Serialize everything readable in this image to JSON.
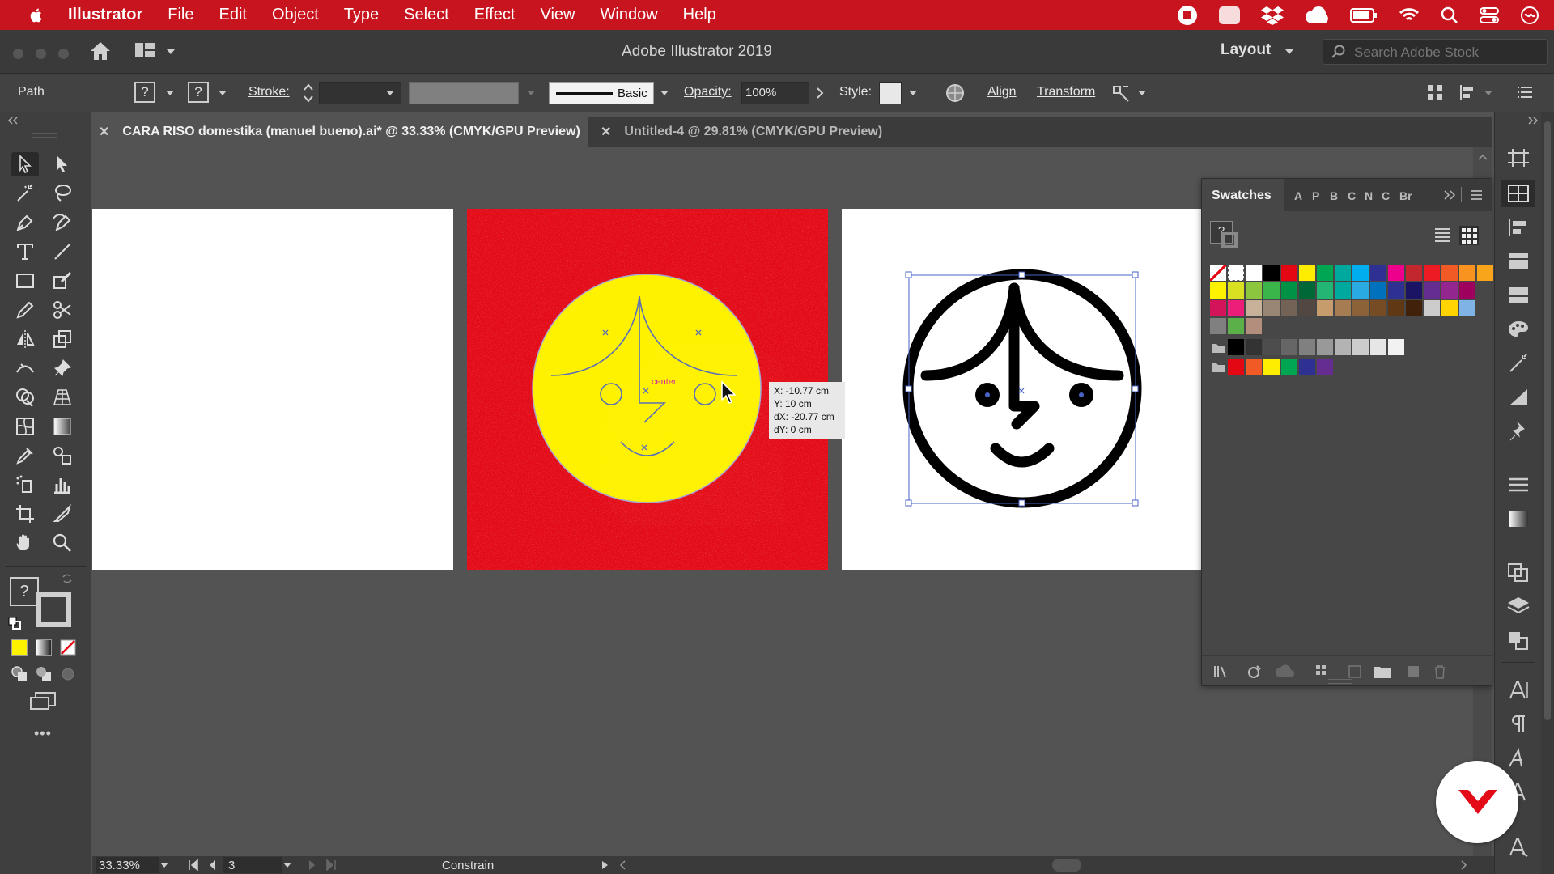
{
  "menubar": {
    "app": "Illustrator",
    "items": [
      "File",
      "Edit",
      "Object",
      "Type",
      "Select",
      "Effect",
      "View",
      "Window",
      "Help"
    ]
  },
  "titlebar": {
    "title": "Adobe Illustrator 2019",
    "workspace": "Layout",
    "search_placeholder": "Search Adobe Stock"
  },
  "control": {
    "selection": "Path",
    "fill_glyph": "?",
    "stroke_glyph": "?",
    "stroke_label": "Stroke:",
    "brush_label": "Basic",
    "opacity_label": "Opacity:",
    "opacity_value": "100%",
    "style_label": "Style:",
    "align_label": "Align",
    "transform_label": "Transform"
  },
  "tabs": [
    {
      "label": "CARA RISO domestika (manuel bueno).ai* @ 33.33% (CMYK/GPU Preview)",
      "active": true
    },
    {
      "label": "Untitled-4 @ 29.81% (CMYK/GPU Preview)",
      "active": false
    }
  ],
  "toolbar": {
    "stroke_fill_glyph": "?",
    "more": "•••"
  },
  "canvas": {
    "smart_guide_label": "center",
    "tooltip": {
      "x": "X: -10.77 cm",
      "y": "Y: 10 cm",
      "dx": "dX: -20.77 cm",
      "dy": "dY: 0 cm"
    }
  },
  "swatches": {
    "title": "Swatches",
    "tabs": [
      "A",
      "P",
      "B",
      "C",
      "N",
      "C",
      "Br"
    ],
    "none_glyph": "?",
    "colors": {
      "row1": [
        "#ffffff",
        "#000000",
        "#e30613",
        "#ffed00",
        "#00a651",
        "#00a99d",
        "#00aeef",
        "#2e3192",
        "#ec008c",
        "#c1272d",
        "#ed1c24",
        "#f15a24",
        "#f7931e",
        "#f8a51c"
      ],
      "row2": [
        "#fff200",
        "#d9e021",
        "#8cc63f",
        "#39b54a",
        "#009245",
        "#006837",
        "#22b573",
        "#00a99d",
        "#29abe2",
        "#0071bc",
        "#2e3192",
        "#1b1464",
        "#662d91",
        "#93278f",
        "#9e005d"
      ],
      "row3": [
        "#d4145a",
        "#ed1e79",
        "#c7b299",
        "#998675",
        "#736357",
        "#534741",
        "#c69c6d",
        "#a67c52",
        "#8c6239",
        "#754c24",
        "#603813",
        "#42210b",
        "#cccccc",
        "#ffd400",
        "#7fb2e5"
      ],
      "row4": [
        "#808080",
        "#5bb04a",
        "#b38e7d"
      ],
      "gray": [
        "#000000",
        "#333333",
        "#4d4d4d",
        "#666666",
        "#808080",
        "#999999",
        "#b3b3b3",
        "#cccccc",
        "#e6e6e6",
        "#f2f2f2"
      ],
      "group": [
        "#e30613",
        "#f15a24",
        "#ffed00",
        "#00a651",
        "#2e3192",
        "#662d91"
      ]
    }
  },
  "status": {
    "zoom": "33.33%",
    "artboard": "3",
    "mode": "Constrain"
  }
}
